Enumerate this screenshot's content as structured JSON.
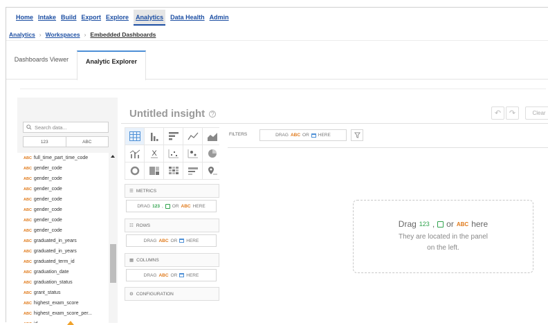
{
  "nav": {
    "items": [
      "Home",
      "Intake",
      "Build",
      "Export",
      "Explore",
      "Analytics",
      "Data Health",
      "Admin"
    ],
    "active": "Analytics"
  },
  "breadcrumb": [
    "Analytics",
    "Workspaces",
    "Embedded Dashboards"
  ],
  "tabs": [
    "Dashboards Viewer",
    "Analytic Explorer"
  ],
  "insight": {
    "title": "Untitled insight",
    "clear_label": "Clear"
  },
  "search": {
    "placeholder": "Search data..."
  },
  "type_filter": [
    "123",
    "ABC"
  ],
  "type_tag": "ABC",
  "fields": [
    "full_time_part_time_code",
    "gender_code",
    "gender_code",
    "gender_code",
    "gender_code",
    "gender_code",
    "gender_code",
    "gender_code",
    "graduated_in_years",
    "graduated_in_years",
    "graduated_term_id",
    "graduation_date",
    "graduation_status",
    "grant_status",
    "highest_exam_score",
    "highest_exam_score_per...",
    "id"
  ],
  "buckets": {
    "metrics": {
      "label": "METRICS",
      "drag_pre": "DRAG",
      "num": "123",
      "mid": ",",
      "or": "OR",
      "abc": "ABC",
      "post": "HERE"
    },
    "rows": {
      "label": "ROWS",
      "drag_pre": "DRAG",
      "abc": "ABC",
      "or": "OR",
      "post": "HERE"
    },
    "columns": {
      "label": "COLUMNS",
      "drag_pre": "DRAG",
      "abc": "ABC",
      "or": "OR",
      "post": "HERE"
    },
    "configuration": {
      "label": "CONFIGURATION"
    }
  },
  "filters": {
    "label": "FILTERS",
    "drag_pre": "DRAG",
    "abc": "ABC",
    "or": "OR",
    "post": "HERE"
  },
  "dropzone": {
    "drag": "Drag",
    "num": "123",
    "comma": ",",
    "or": "or",
    "abc": "ABC",
    "here": "here",
    "line2": "They are located in the panel",
    "line3": "on the left."
  },
  "colors": {
    "link": "#1d4fa3",
    "accent": "#4c8fd6",
    "abc": "#e07a1b",
    "num": "#2fa24c"
  }
}
